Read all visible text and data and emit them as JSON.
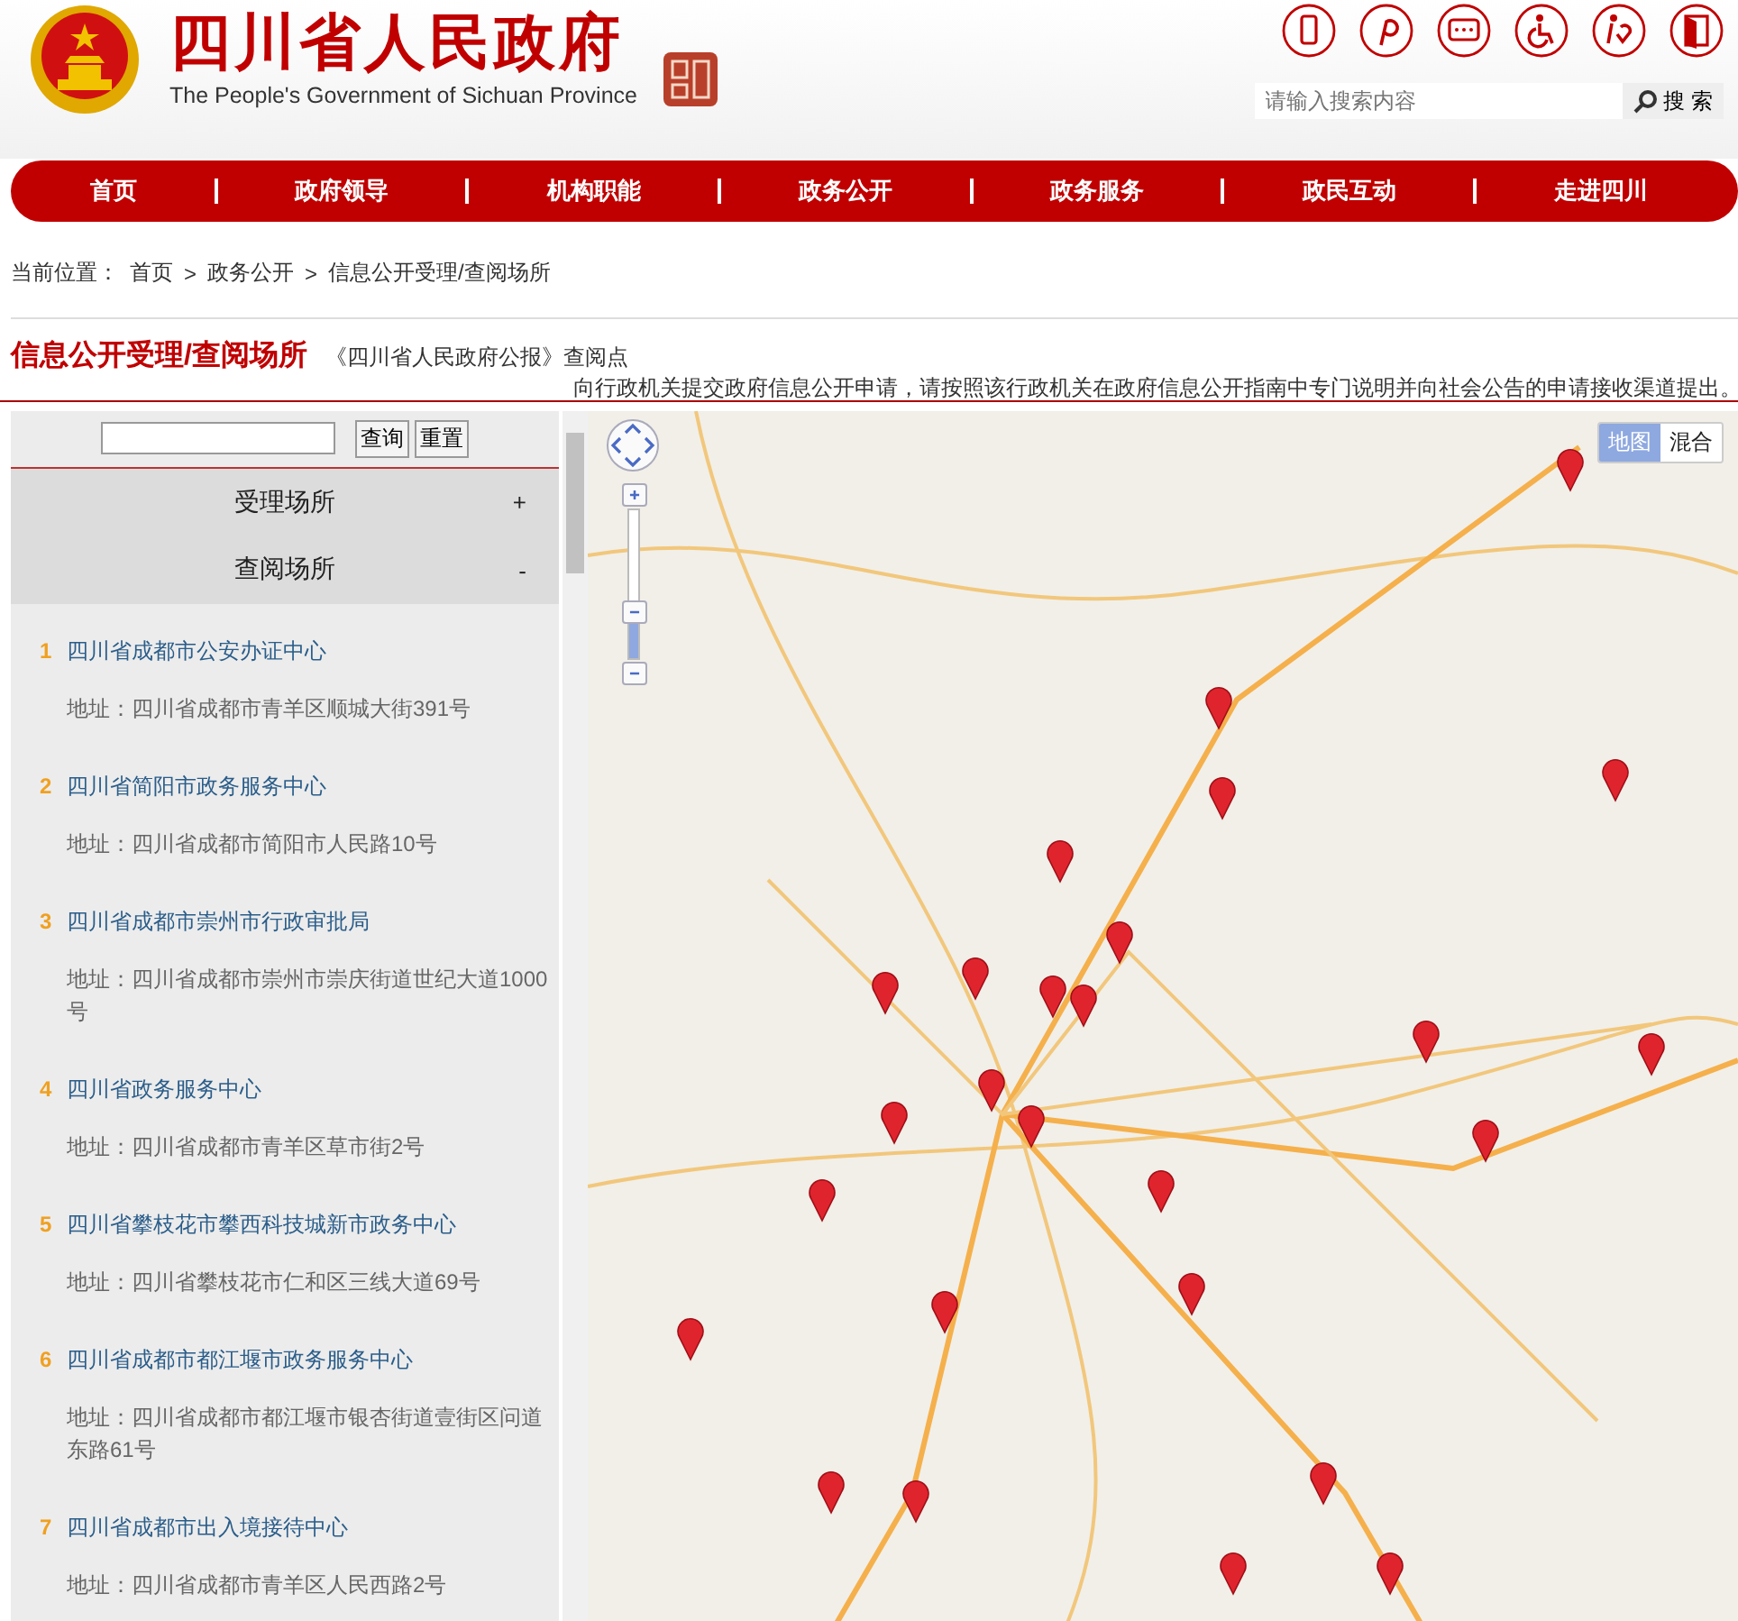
{
  "header": {
    "title": "四川省人民政府",
    "subtitle": "The People's Government of Sichuan Province",
    "search": {
      "placeholder": "请输入搜索内容",
      "button": "搜 索"
    }
  },
  "nav": [
    "首页",
    "政府领导",
    "机构职能",
    "政务公开",
    "政务服务",
    "政民互动",
    "走进四川"
  ],
  "breadcrumb": {
    "label": "当前位置：",
    "separator": ">",
    "items": [
      "首页",
      "政务公开",
      "信息公开受理/查阅场所"
    ]
  },
  "page_title": {
    "title": "信息公开受理/查阅场所",
    "link": "《四川省人民政府公报》查阅点",
    "notice": "向行政机关提交政府信息公开申请，请按照该行政机关在政府信息公开指南中专门说明并向社会公告的申请接收渠道提出。"
  },
  "sidebar": {
    "search": {
      "buttons": [
        "查询",
        "重置"
      ]
    },
    "sections": [
      {
        "title": "受理场所",
        "toggle": "+",
        "expanded": false
      },
      {
        "title": "查阅场所",
        "toggle": "-",
        "expanded": true
      }
    ],
    "places": [
      {
        "number": "1",
        "name": "四川省成都市公安办证中心",
        "address": "地址：四川省成都市青羊区顺城大街391号"
      },
      {
        "number": "2",
        "name": "四川省简阳市政务服务中心",
        "address": "地址：四川省成都市简阳市人民路10号"
      },
      {
        "number": "3",
        "name": "四川省成都市崇州市行政审批局",
        "address": "地址：四川省成都市崇州市崇庆街道世纪大道1000号"
      },
      {
        "number": "4",
        "name": "四川省政务服务中心",
        "address": "地址：四川省成都市青羊区草市街2号"
      },
      {
        "number": "5",
        "name": "四川省攀枝花市攀西科技城新市政务中心",
        "address": "地址：四川省攀枝花市仁和区三线大道69号"
      },
      {
        "number": "6",
        "name": "四川省成都市都江堰市政务服务中心",
        "address": "地址：四川省成都市都江堰市银杏街道壹街区问道东路61号"
      },
      {
        "number": "7",
        "name": "四川省成都市出入境接待中心",
        "address": "地址：四川省成都市青羊区人民西路2号"
      }
    ]
  },
  "map": {
    "zoom": {
      "level": 0.37
    },
    "map_types": [
      {
        "label": "地图",
        "selected": true
      },
      {
        "label": "混合",
        "selected": false
      }
    ]
  }
}
